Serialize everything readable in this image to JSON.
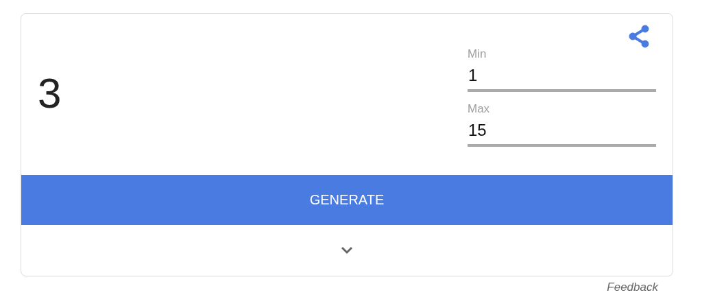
{
  "result": "3",
  "fields": [
    {
      "label": "Min",
      "value": "1"
    },
    {
      "label": "Max",
      "value": "15"
    }
  ],
  "generate_button": "GENERATE",
  "details": {
    "expanded": false
  },
  "feedback": "Feedback"
}
